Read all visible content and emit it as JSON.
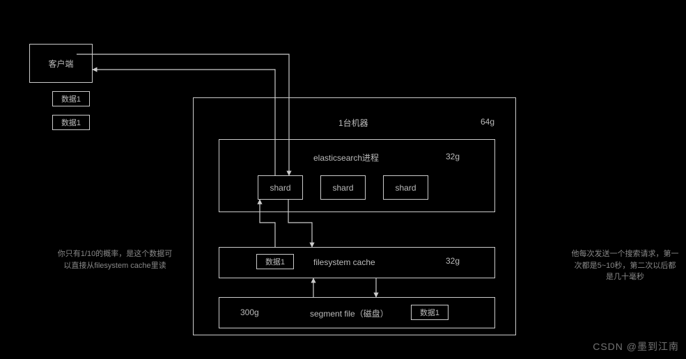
{
  "client": {
    "label": "客户端"
  },
  "data_tags": {
    "d1": "数据1",
    "d2": "数据1",
    "d_fs": "数据1",
    "d_seg": "数据1"
  },
  "machine": {
    "title": "1台机器",
    "mem": "64g"
  },
  "process": {
    "title": "elasticsearch进程",
    "mem": "32g"
  },
  "shards": {
    "s1": "shard",
    "s2": "shard",
    "s3": "shard"
  },
  "fscache": {
    "title": "filesystem cache",
    "mem": "32g"
  },
  "segment": {
    "title": "segment file（磁盘）",
    "size": "300g"
  },
  "notes": {
    "left": "你只有1/10的概率，是这个数据可以直接从filesystem cache里读",
    "right": "他每次发送一个搜索请求，第一次都是5~10秒，第二次以后都是几十毫秒"
  },
  "watermark": "CSDN @墨到江南"
}
